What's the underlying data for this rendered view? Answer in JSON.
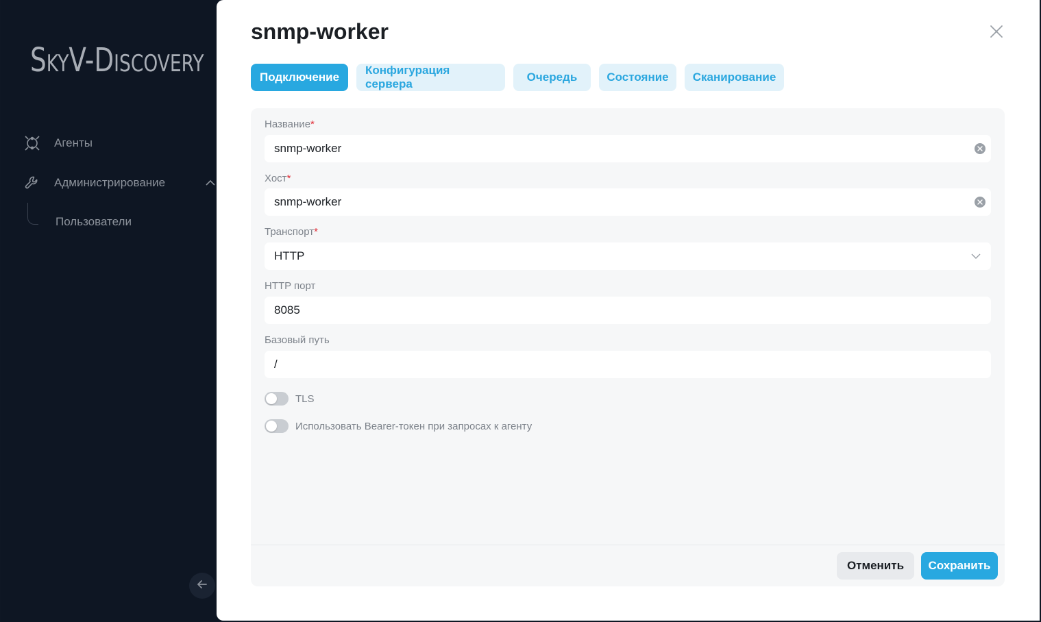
{
  "app": {
    "logo_first": "S",
    "logo_rest1": "ky",
    "logo_v": "V-D",
    "logo_rest2": "iscovery"
  },
  "sidebar": {
    "items": [
      {
        "label": "Агенты",
        "icon": "agents-icon"
      },
      {
        "label": "Администрирование",
        "icon": "wrench-icon"
      }
    ],
    "sub_items": [
      {
        "label": "Пользователи"
      }
    ]
  },
  "drawer": {
    "title": "snmp-worker",
    "tabs": [
      {
        "label": "Подключение",
        "active": true
      },
      {
        "label": "Конфигурация сервера",
        "active": false
      },
      {
        "label": "Очередь",
        "active": false
      },
      {
        "label": "Состояние",
        "active": false
      },
      {
        "label": "Сканирование",
        "active": false
      }
    ],
    "form": {
      "name_label": "Название",
      "name_value": "snmp-worker",
      "host_label": "Хост",
      "host_value": "snmp-worker",
      "transport_label": "Транспорт",
      "transport_value": "HTTP",
      "port_label": "HTTP порт",
      "port_value": "8085",
      "base_path_label": "Базовый путь",
      "base_path_value": "/",
      "tls_label": "TLS",
      "tls_enabled": false,
      "bearer_label": "Использовать Bearer-токен при запросах к агенту",
      "bearer_enabled": false,
      "required_mark": "*"
    },
    "buttons": {
      "cancel": "Отменить",
      "save": "Сохранить"
    }
  },
  "colors": {
    "accent": "#28a8e0",
    "sidebar_bg": "#0e1623",
    "required": "#e0303a"
  }
}
